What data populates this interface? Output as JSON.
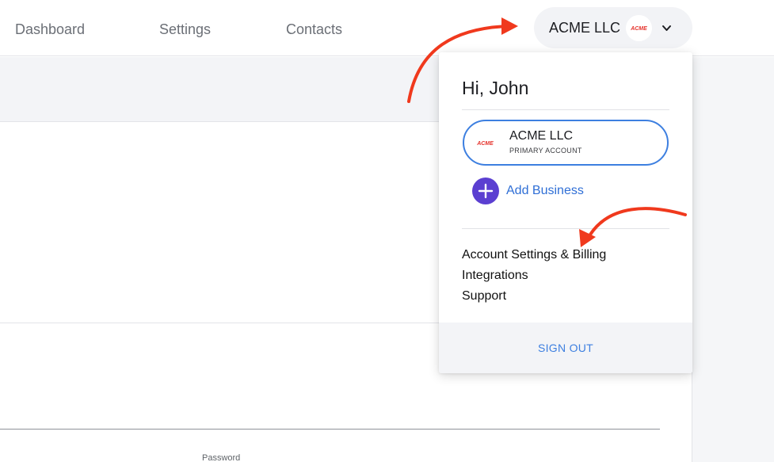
{
  "nav": {
    "items": [
      {
        "label": "Dashboard"
      },
      {
        "label": "Settings"
      },
      {
        "label": "Contacts"
      }
    ],
    "account": {
      "name": "ACME LLC",
      "logo_text": "ACME",
      "icon": "chevron-down-icon"
    }
  },
  "dropdown": {
    "greeting": "Hi, John",
    "current_account": {
      "name": "ACME LLC",
      "subtitle": "PRIMARY ACCOUNT",
      "logo_text": "ACME"
    },
    "add_business": {
      "label": "Add Business",
      "icon": "plus-icon"
    },
    "menu_items": [
      {
        "label": "Account Settings & Billing"
      },
      {
        "label": "Integrations"
      },
      {
        "label": "Support"
      }
    ],
    "sign_out": "SIGN OUT"
  },
  "form": {
    "password_label": "Password"
  },
  "colors": {
    "accent_blue": "#3d7fe0",
    "add_button_purple": "#5b3fd1",
    "logo_red": "#e5322b",
    "annotation_arrow": "#f0391d"
  }
}
